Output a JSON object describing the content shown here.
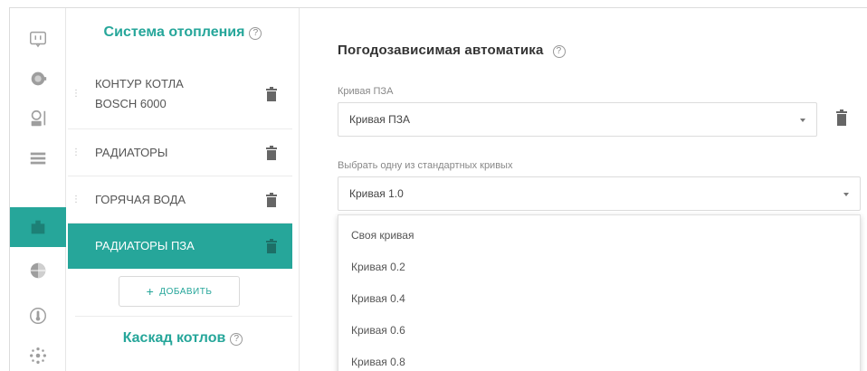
{
  "rail": {
    "items": [
      {
        "icon": "messages-icon",
        "active": false
      },
      {
        "icon": "boiler-icon",
        "active": false
      },
      {
        "icon": "user-sensor-icon",
        "active": false
      },
      {
        "icon": "list-icon",
        "active": false
      },
      {
        "icon": "heating-system-icon",
        "active": true
      },
      {
        "icon": "globe-icon",
        "active": false
      },
      {
        "icon": "thermometer-icon",
        "active": false
      },
      {
        "icon": "network-icon",
        "active": false
      }
    ]
  },
  "heating": {
    "title": "Система отопления",
    "help_mark": "?",
    "circuits": [
      {
        "label_line1": "КОНТУР КОТЛА",
        "label_line2": "BOSCH 6000",
        "active": false
      },
      {
        "label_line1": "РАДИАТОРЫ",
        "label_line2": "",
        "active": false
      },
      {
        "label_line1": "ГОРЯЧАЯ ВОДА",
        "label_line2": "",
        "active": false
      },
      {
        "label_line1": "РАДИАТОРЫ ПЗА",
        "label_line2": "",
        "active": true
      }
    ],
    "add_label": "ДОБАВИТЬ",
    "add_plus": "+"
  },
  "cascade": {
    "title": "Каскад котлов",
    "help_mark": "?"
  },
  "main": {
    "title": "Погодозависимая автоматика",
    "help_mark": "?",
    "curve_field": {
      "label": "Кривая ПЗА",
      "value": "Кривая ПЗА"
    },
    "standard_field": {
      "label": "Выбрать одну из стандартных кривых",
      "value": "Кривая 1.0"
    },
    "dropdown_options": [
      "Своя кривая",
      "Кривая 0.2",
      "Кривая 0.4",
      "Кривая 0.6",
      "Кривая 0.8"
    ]
  },
  "colors": {
    "accent": "#26a69a",
    "icon_gray": "#9e9e9e"
  }
}
